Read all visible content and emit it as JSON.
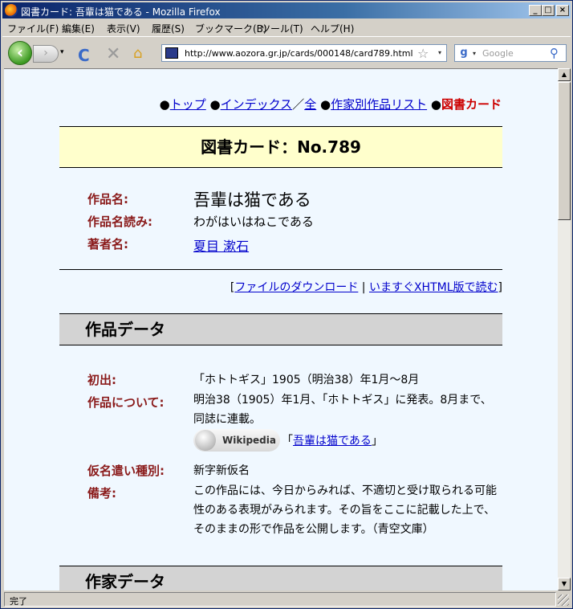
{
  "window": {
    "title": "図書カード: 吾輩は猫である - Mozilla Firefox",
    "min_glyph": "_",
    "max_glyph": "□",
    "close_glyph": "×"
  },
  "menu": [
    "ファイル(F)",
    "編集(E)",
    "表示(V)",
    "履歴(S)",
    "ブックマーク(B)",
    "ツール(T)",
    "ヘルプ(H)"
  ],
  "toolbar": {
    "back_glyph": "‹",
    "forward_glyph": "›",
    "dropdown_glyph": "▾",
    "reload_glyph": "C",
    "stop_glyph": "✕",
    "home_glyph": "⌂",
    "url": "http://www.aozora.gr.jp/cards/000148/card789.html",
    "star_glyph": "☆",
    "search_engine_glyph": "g",
    "search_placeholder": "Google",
    "search_glyph": "⚲"
  },
  "breadcrumbs": {
    "bullet": "●",
    "top": "トップ",
    "index": "インデックス",
    "sep": "／",
    "all": "全",
    "authors": "作家別作品リスト",
    "current": "図書カード"
  },
  "card_title": "図書カード：No.789",
  "info": {
    "title_label": "作品名:",
    "title_value": "吾輩は猫である",
    "reading_label": "作品名読み:",
    "reading_value": "わがはいはねこである",
    "author_label": "著者名:",
    "author_value": "夏目 漱石"
  },
  "links": {
    "open": "[",
    "download": "ファイルのダウンロード",
    "sep": " | ",
    "read_now": "いますぐXHTML版で読む",
    "close": "]"
  },
  "work_data": {
    "heading": "作品データ",
    "first_pub_label": "初出:",
    "first_pub_value": "「ホトトギス」1905（明治38）年1月～8月",
    "about_label": "作品について:",
    "about_value": "明治38（1905）年1月、「ホトトギス」に発表。8月まで、同誌に連載。",
    "wikipedia_badge": "Wikipedia",
    "wiki_open": "「",
    "wiki_link": "吾輩は猫である",
    "wiki_close": "」",
    "kana_label": "仮名遣い種別:",
    "kana_value": "新字新仮名",
    "notes_label": "備考:",
    "notes_value": "この作品には、今日からみれば、不適切と受け取られる可能性のある表現がみられます。その旨をここに記載した上で、そのままの形で作品を公開します。（青空文庫）"
  },
  "author_data": {
    "heading": "作家データ"
  },
  "scrollbar": {
    "up": "▲",
    "down": "▼"
  },
  "status": "完了"
}
